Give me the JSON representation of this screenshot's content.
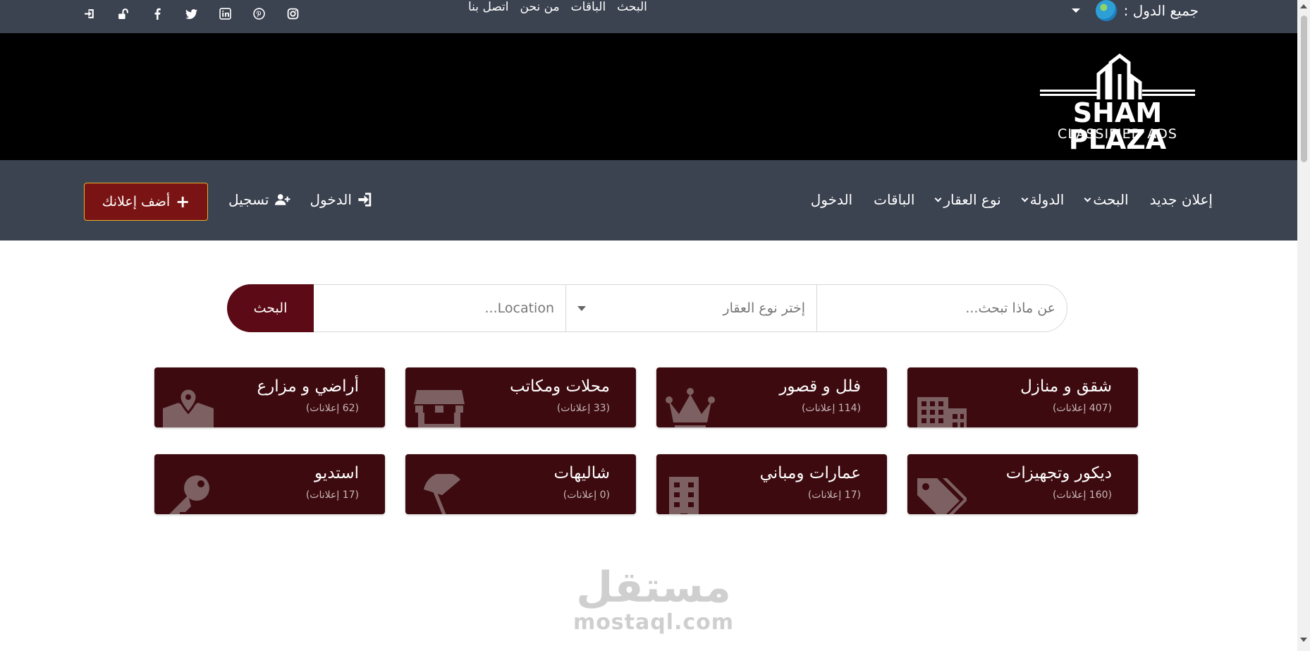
{
  "topbar": {
    "country_label": "جميع الدول :",
    "links": [
      "البحث",
      "الباقات",
      "من نحن",
      "اتصل بنا"
    ],
    "social_icons": [
      "instagram-icon",
      "pinterest-icon",
      "linkedin-icon",
      "twitter-icon",
      "facebook-icon",
      "unlock-icon",
      "sign-in-icon"
    ]
  },
  "logo": {
    "title": "SHAM PLAZA",
    "subtitle": "CLASSIFIED ADS"
  },
  "nav": {
    "items": [
      {
        "label": "إعلان جديد",
        "dropdown": false
      },
      {
        "label": "البحث",
        "dropdown": true
      },
      {
        "label": "الدولة",
        "dropdown": true
      },
      {
        "label": "نوع العقار",
        "dropdown": true
      },
      {
        "label": "الباقات",
        "dropdown": false
      },
      {
        "label": "الدخول",
        "dropdown": false
      }
    ],
    "login_label": "الدخول",
    "register_label": "تسجيل",
    "add_listing_label": "أضف إعلانك"
  },
  "search": {
    "keyword_placeholder": "عن ماذا تبحث...",
    "type_placeholder": "إختر نوع العقار",
    "location_placeholder": "Location...",
    "button_label": "البحث"
  },
  "categories": [
    {
      "name": "شقق و منازل",
      "count": "(407 إعلانات)",
      "icon": "building-icon"
    },
    {
      "name": "فلل و قصور",
      "count": "(114 إعلانات)",
      "icon": "crown-icon"
    },
    {
      "name": "محلات ومكاتب",
      "count": "(33 إعلانات)",
      "icon": "store-icon"
    },
    {
      "name": "أراضي و مزارع",
      "count": "(62 إعلانات)",
      "icon": "map-icon"
    },
    {
      "name": "ديكور وتجهيزات",
      "count": "(160 إعلانات)",
      "icon": "tags-icon"
    },
    {
      "name": "عمارات ومباني",
      "count": "(17 إعلانات)",
      "icon": "office-building-icon"
    },
    {
      "name": "شاليهات",
      "count": "(0 إعلانات)",
      "icon": "umbrella-beach-icon"
    },
    {
      "name": "استديو",
      "count": "(17 إعلانات)",
      "icon": "key-icon"
    }
  ],
  "watermark": {
    "arabic": "مستقل",
    "latin": "mostaql.com"
  },
  "colors": {
    "topbar_bg": "#3b4250",
    "banner_bg": "#000000",
    "card_bg": "#3d0a0f",
    "search_button_bg": "#5c0a15",
    "add_button_bg": "#7a1414",
    "add_button_border": "#e0b22b"
  }
}
